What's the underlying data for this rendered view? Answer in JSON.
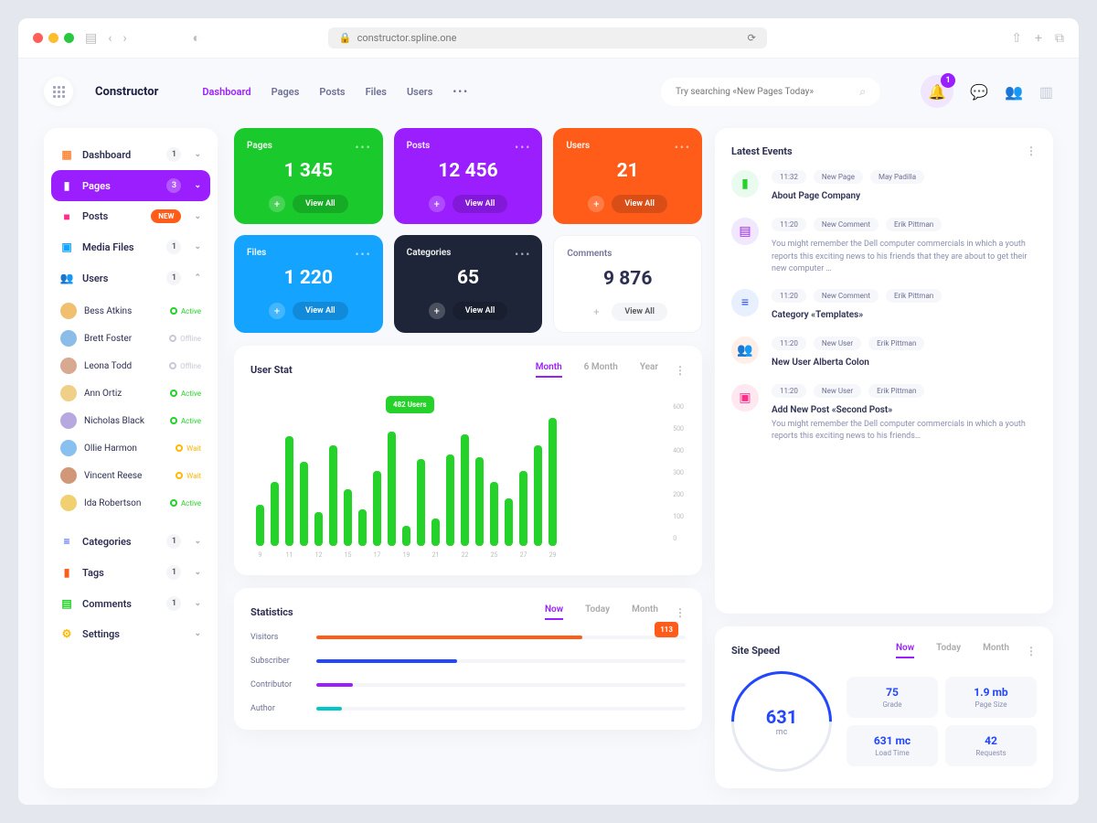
{
  "browser": {
    "url": "constructor.spline.one"
  },
  "header": {
    "brand": "Constructor",
    "nav": [
      "Dashboard",
      "Pages",
      "Posts",
      "Files",
      "Users"
    ],
    "search_placeholder": "Try searching «New Pages Today»",
    "notif_count": "1"
  },
  "sidebar": {
    "dashboard": {
      "label": "Dashboard",
      "count": "1"
    },
    "pages": {
      "label": "Pages",
      "count": "3"
    },
    "posts": {
      "label": "Posts",
      "badge": "NEW"
    },
    "media": {
      "label": "Media Files",
      "count": "1"
    },
    "users": {
      "label": "Users",
      "count": "1"
    },
    "userlist": [
      {
        "name": "Bess Atkins",
        "status": "Active",
        "color": "#25d22a"
      },
      {
        "name": "Brett Foster",
        "status": "Offline",
        "color": "#c7c9d6"
      },
      {
        "name": "Leona Todd",
        "status": "Offline",
        "color": "#c7c9d6"
      },
      {
        "name": "Ann Ortiz",
        "status": "Active",
        "color": "#25d22a"
      },
      {
        "name": "Nicholas Black",
        "status": "Active",
        "color": "#25d22a"
      },
      {
        "name": "Ollie Harmon",
        "status": "Wait",
        "color": "#ffb800"
      },
      {
        "name": "Vincent Reese",
        "status": "Wait",
        "color": "#ffb800"
      },
      {
        "name": "Ida Robertson",
        "status": "Active",
        "color": "#25d22a"
      }
    ],
    "categories": {
      "label": "Categories",
      "count": "1"
    },
    "tags": {
      "label": "Tags",
      "count": "1"
    },
    "comments": {
      "label": "Comments",
      "count": "1"
    },
    "settings": {
      "label": "Settings"
    }
  },
  "tiles": [
    {
      "label": "Pages",
      "value": "1 345",
      "bg": "#1ac92b",
      "view": "View All"
    },
    {
      "label": "Posts",
      "value": "12 456",
      "bg": "#9b1efe",
      "view": "View All"
    },
    {
      "label": "Users",
      "value": "21",
      "bg": "#ff5c1a",
      "view": "View All"
    },
    {
      "label": "Files",
      "value": "1 220",
      "bg": "#14a4ff",
      "view": "View All"
    },
    {
      "label": "Categories",
      "value": "65",
      "bg": "#1e2538",
      "view": "View All"
    },
    {
      "label": "Comments",
      "value": "9 876",
      "bg": "",
      "view": "View All"
    }
  ],
  "userstat": {
    "title": "User Stat",
    "tabs": [
      "Month",
      "6 Month",
      "Year"
    ],
    "tooltip": "482 Users"
  },
  "chart_data": {
    "type": "bar",
    "title": "User Stat",
    "xlabel": "",
    "ylabel": "",
    "ylim": [
      0,
      600
    ],
    "x_ticks": [
      "9",
      "11",
      "12",
      "15",
      "17",
      "19",
      "21",
      "22",
      "25",
      "27",
      "29"
    ],
    "y_ticks": [
      600,
      500,
      400,
      300,
      200,
      100,
      0
    ],
    "values": [
      180,
      280,
      482,
      370,
      150,
      440,
      250,
      160,
      330,
      500,
      90,
      380,
      120,
      400,
      490,
      390,
      280,
      210,
      330,
      440,
      560
    ]
  },
  "statistics": {
    "title": "Statistics",
    "tabs": [
      "Now",
      "Today",
      "Month"
    ],
    "tag": "113",
    "rows": [
      {
        "label": "Visitors",
        "percent": 72,
        "color": "#ff5c1a"
      },
      {
        "label": "Subscriber",
        "percent": 38,
        "color": "#2346ff"
      },
      {
        "label": "Contributor",
        "percent": 10,
        "color": "#9b1efe"
      },
      {
        "label": "Author",
        "percent": 7,
        "color": "#00c8c8"
      }
    ]
  },
  "events": {
    "title": "Latest Events",
    "items": [
      {
        "ic_bg": "#e8fbee",
        "ic_color": "#25d22a",
        "pills": [
          "11:32",
          "New Page",
          "May Padilla"
        ],
        "title": "About Page Company",
        "desc": ""
      },
      {
        "ic_bg": "#f1e8ff",
        "ic_color": "#9b1efe",
        "pills": [
          "11:20",
          "New Comment",
          "Erik Pittman"
        ],
        "title": "",
        "desc": "You might remember the Dell computer commercials in which a youth reports this exciting news to his friends that they are about to get their new computer …"
      },
      {
        "ic_bg": "#e8efff",
        "ic_color": "#2346ff",
        "pills": [
          "11:20",
          "New Comment",
          "Erik Pittman"
        ],
        "title": "Category «Templates»",
        "desc": ""
      },
      {
        "ic_bg": "#ffefe8",
        "ic_color": "#ff5c1a",
        "pills": [
          "11:20",
          "New User",
          "Erik Pittman"
        ],
        "title": "New User Alberta Colon",
        "desc": ""
      },
      {
        "ic_bg": "#ffe8f0",
        "ic_color": "#ff2d8a",
        "pills": [
          "11:20",
          "New User",
          "Erik Pittman"
        ],
        "title": "Add New Post «Second Post»",
        "desc": "You might remember the Dell computer commercials in which a youth reports this exciting news to his friends…"
      }
    ]
  },
  "speed": {
    "title": "Site Speed",
    "tabs": [
      "Now",
      "Today",
      "Month"
    ],
    "value": "631",
    "unit": "mc",
    "cells": [
      {
        "v": "75",
        "l": "Grade"
      },
      {
        "v": "1.9 mb",
        "l": "Page Size"
      },
      {
        "v": "631 mc",
        "l": "Load Time"
      },
      {
        "v": "42",
        "l": "Requests"
      }
    ]
  },
  "avatars": [
    "#f0c070",
    "#8bbde8",
    "#d8a890",
    "#f0d088",
    "#b8a8e0",
    "#88c0f0",
    "#d09878",
    "#f0d070"
  ]
}
